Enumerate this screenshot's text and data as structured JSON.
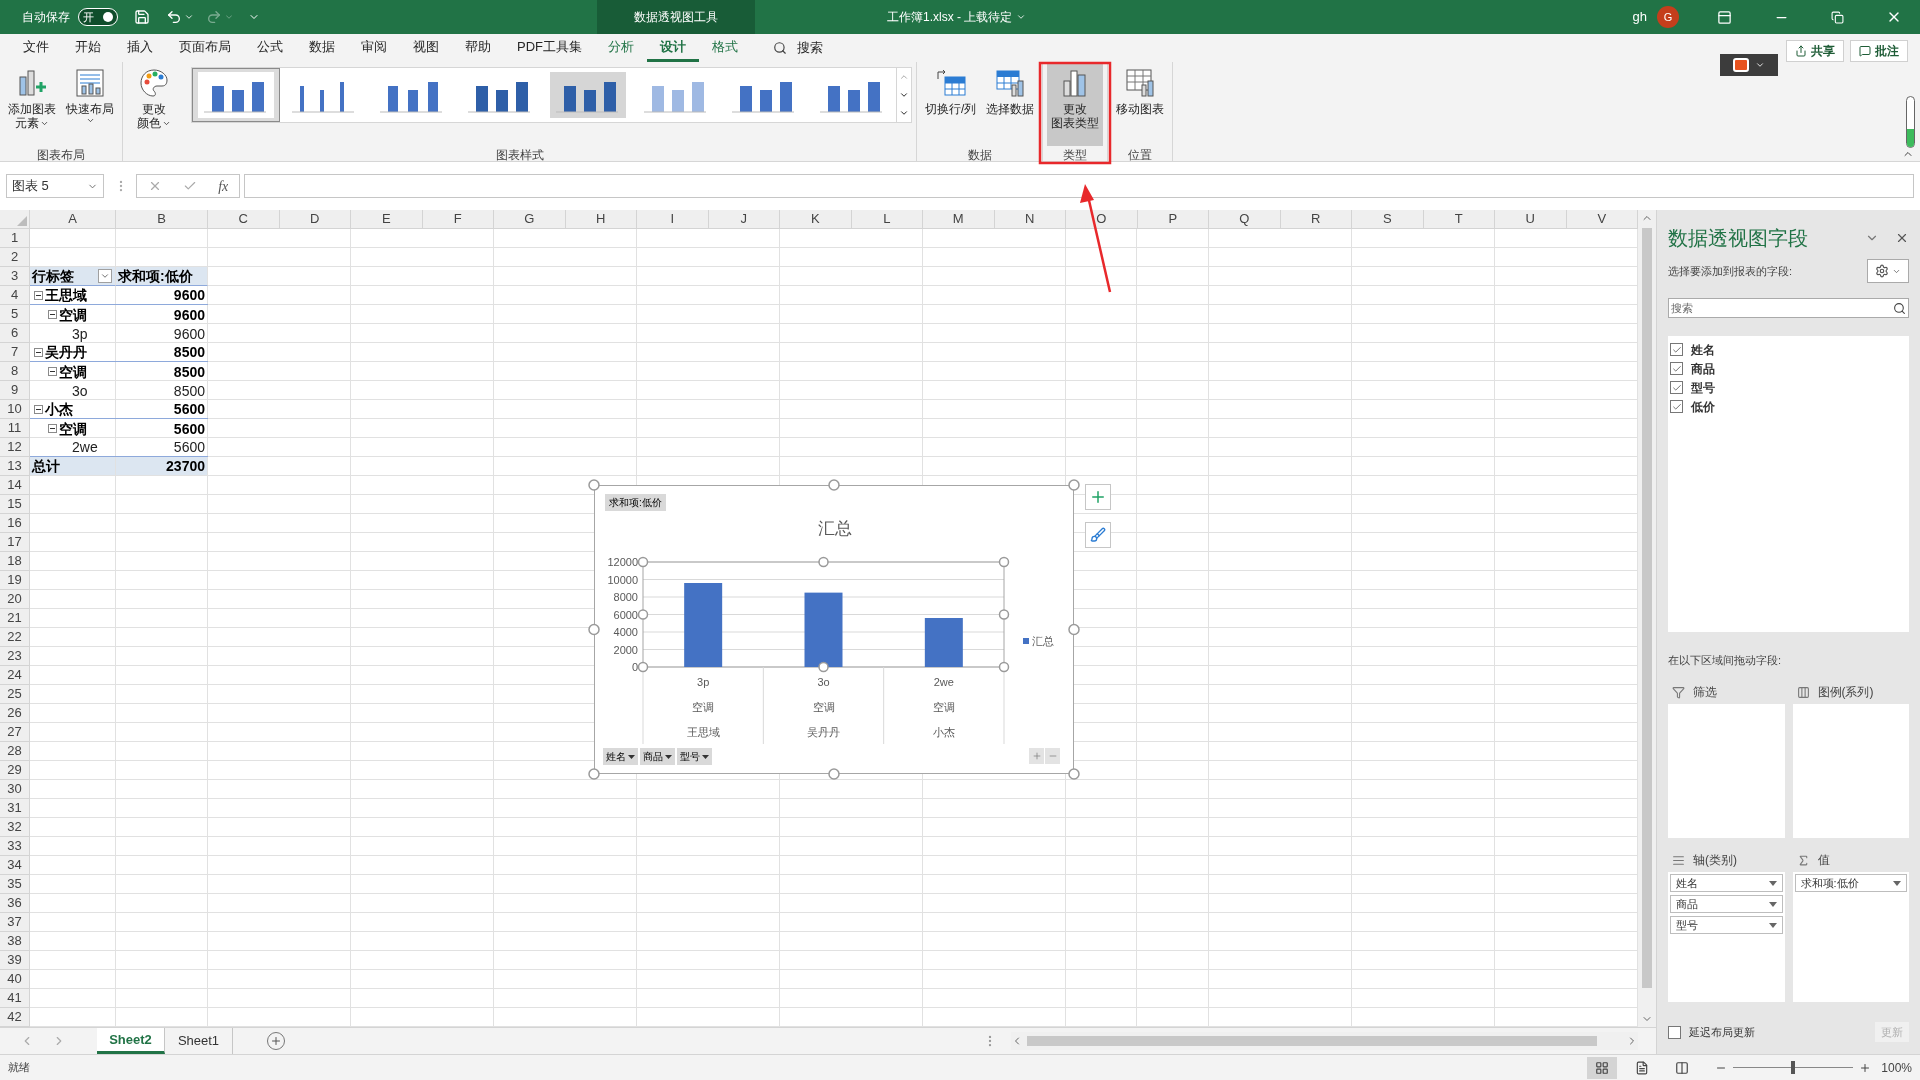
{
  "title_bar": {
    "autosave_label": "自动保存",
    "autosave_toggle": {
      "label": "开",
      "on": true
    },
    "context_tab": "数据透视图工具",
    "document_title": "工作簿1.xlsx - 上载待定",
    "user": "gh",
    "avatar": "G"
  },
  "menu_tabs": [
    {
      "label": "文件",
      "kind": "plain",
      "selected": false
    },
    {
      "label": "开始",
      "kind": "plain",
      "selected": false
    },
    {
      "label": "插入",
      "kind": "plain",
      "selected": false
    },
    {
      "label": "页面布局",
      "kind": "plain",
      "selected": false
    },
    {
      "label": "公式",
      "kind": "plain",
      "selected": false
    },
    {
      "label": "数据",
      "kind": "plain",
      "selected": false
    },
    {
      "label": "审阅",
      "kind": "plain",
      "selected": false
    },
    {
      "label": "视图",
      "kind": "plain",
      "selected": false
    },
    {
      "label": "帮助",
      "kind": "plain",
      "selected": false
    },
    {
      "label": "PDF工具集",
      "kind": "plain",
      "selected": false
    },
    {
      "label": "分析",
      "kind": "context",
      "selected": false
    },
    {
      "label": "设计",
      "kind": "context",
      "selected": true
    },
    {
      "label": "格式",
      "kind": "context",
      "selected": false
    }
  ],
  "search_label": "搜索",
  "share_button": "共享",
  "comments_button": "批注",
  "ribbon_groups": [
    {
      "kind": "buttons",
      "label": "图表布局",
      "buttons": [
        {
          "kind": "add-element",
          "lines": [
            "添加图表",
            "元素"
          ],
          "menu": true,
          "highlighted": false
        },
        {
          "kind": "quick-layout",
          "lines": [
            "快速布局"
          ],
          "menu": true,
          "highlighted": false
        }
      ]
    },
    {
      "kind": "styles",
      "label": "图表样式",
      "buttons": [
        {
          "kind": "colors",
          "lines": [
            "更改",
            "颜色"
          ],
          "menu": true,
          "highlighted": false
        }
      ]
    },
    {
      "kind": "buttons",
      "label": "数据",
      "buttons": [
        {
          "kind": "switch",
          "lines": [
            "切换行/列"
          ],
          "menu": false,
          "highlighted": false
        },
        {
          "kind": "select",
          "lines": [
            "选择数据"
          ],
          "menu": false,
          "highlighted": false
        }
      ]
    },
    {
      "kind": "buttons",
      "label": "类型",
      "buttons": [
        {
          "kind": "change-type",
          "lines": [
            "更改",
            "图表类型"
          ],
          "menu": false,
          "highlighted": true
        }
      ]
    },
    {
      "kind": "buttons",
      "label": "位置",
      "buttons": [
        {
          "kind": "move",
          "lines": [
            "移动图表"
          ],
          "menu": false,
          "highlighted": false
        }
      ]
    }
  ],
  "chart_styles": [
    {
      "selected": true
    },
    {
      "selected": false
    },
    {
      "selected": false
    },
    {
      "selected": false
    },
    {
      "selected": false
    },
    {
      "selected": false
    },
    {
      "selected": false
    },
    {
      "selected": false
    }
  ],
  "formula_bar": {
    "name_box": "图表 5",
    "function_label": "fx"
  },
  "sheet": {
    "columns": [
      "A",
      "B",
      "C",
      "D",
      "E",
      "F",
      "G",
      "H",
      "I",
      "J",
      "K",
      "L",
      "M",
      "N",
      "O",
      "P",
      "Q",
      "R",
      "S",
      "T",
      "U",
      "V"
    ],
    "row_numbers": [
      "1",
      "2",
      "3",
      "4",
      "5",
      "6",
      "7",
      "8",
      "9",
      "10",
      "11",
      "12",
      "13",
      "14",
      "15",
      "16",
      "17",
      "18",
      "19",
      "20",
      "21",
      "22",
      "23",
      "24",
      "25",
      "26",
      "27",
      "28",
      "29",
      "30",
      "31",
      "32",
      "33",
      "34",
      "35",
      "36",
      "37",
      "38",
      "39",
      "40",
      "41",
      "42"
    ]
  },
  "pivot": {
    "headers": [
      "行标签",
      "求和项:低价"
    ],
    "rows": [
      {
        "label": "王思域",
        "value": "9600",
        "expanded": true,
        "children": [
          {
            "label": "空调",
            "value": "9600",
            "expanded": true,
            "children": [
              {
                "label": "3p",
                "value": "9600"
              }
            ]
          }
        ]
      },
      {
        "label": "吴丹丹",
        "value": "8500",
        "expanded": true,
        "children": [
          {
            "label": "空调",
            "value": "8500",
            "expanded": true,
            "children": [
              {
                "label": "3o",
                "value": "8500"
              }
            ]
          }
        ]
      },
      {
        "label": "小杰",
        "value": "5600",
        "expanded": true,
        "children": [
          {
            "label": "空调",
            "value": "5600",
            "expanded": true,
            "children": [
              {
                "label": "2we",
                "value": "5600"
              }
            ]
          }
        ]
      }
    ],
    "total": {
      "label": "总计",
      "value": "23700"
    }
  },
  "chart": {
    "field_button": "求和项:低价",
    "chart_data": {
      "type": "bar",
      "title": "汇总",
      "categories": [
        "3p",
        "3o",
        "2we"
      ],
      "series": [
        {
          "name": "汇总",
          "color": "#4472c4",
          "values": [
            9600,
            8500,
            5600
          ]
        }
      ],
      "ylim": [
        0,
        12000
      ],
      "yticks": [
        0,
        2000,
        4000,
        6000,
        8000,
        10000,
        12000
      ],
      "grid": true
    },
    "axis_levels": [
      [
        "空调",
        "空调",
        "空调"
      ],
      [
        "王思域",
        "吴丹丹",
        "小杰"
      ]
    ],
    "axis_buttons": [
      "姓名",
      "商品",
      "型号"
    ]
  },
  "field_panel": {
    "title": "数据透视图字段",
    "subtitle": "选择要添加到报表的字段:",
    "search_placeholder": "搜索",
    "fields": [
      {
        "label": "姓名",
        "checked": true
      },
      {
        "label": "商品",
        "checked": true
      },
      {
        "label": "型号",
        "checked": true
      },
      {
        "label": "低价",
        "checked": true
      }
    ],
    "drag_hint": "在以下区域间拖动字段:",
    "areas": [
      {
        "kind": "filter",
        "label": "筛选"
      },
      {
        "kind": "legend",
        "label": "图例(系列)"
      },
      {
        "kind": "axis",
        "label": "轴(类别)",
        "items": [
          "姓名",
          "商品",
          "型号"
        ]
      },
      {
        "kind": "values",
        "label": "值",
        "items": [
          "求和项:低价"
        ]
      }
    ],
    "defer": {
      "label": "延迟布局更新",
      "checked": false
    },
    "update_button": {
      "label": "更新",
      "disabled": true
    }
  },
  "sheet_tabs": [
    {
      "label": "Sheet2",
      "selected": true
    },
    {
      "label": "Sheet1",
      "selected": false
    }
  ],
  "status_bar": {
    "status": "就绪",
    "views": [
      {
        "kind": "normal",
        "selected": true
      },
      {
        "kind": "page-layout",
        "selected": false
      },
      {
        "kind": "page-break",
        "selected": false
      }
    ],
    "zoom": {
      "label": "100%",
      "level": 0.5
    }
  }
}
